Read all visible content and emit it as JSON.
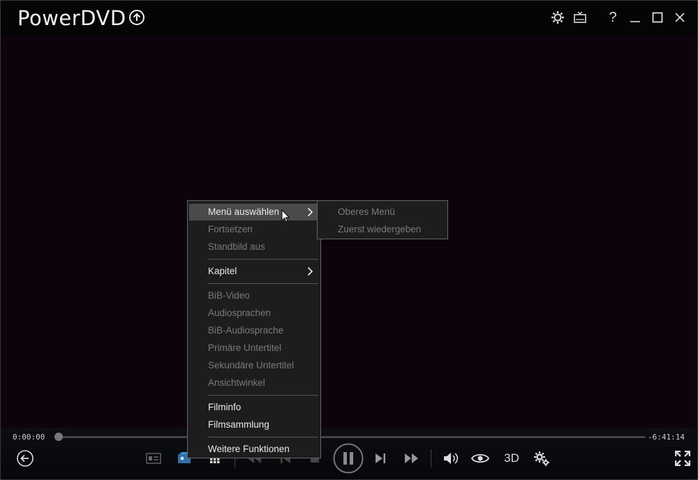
{
  "app": {
    "title": "PowerDVD"
  },
  "titlebar": {
    "icons": [
      "upgrade-icon",
      "gear-icon",
      "tv-mode-icon",
      "help-icon",
      "minimize-icon",
      "maximize-icon",
      "close-icon"
    ],
    "help_glyph": "?"
  },
  "player": {
    "time_elapsed": "0:00:00",
    "time_remaining": "-6:41:14",
    "progress": 0.0,
    "label_3d": "3D"
  },
  "context_menu": {
    "items": [
      {
        "label": "Menü auswählen",
        "enabled": true,
        "submenu": true,
        "highlighted": true
      },
      {
        "label": "Fortsetzen",
        "enabled": false
      },
      {
        "label": "Standbild aus",
        "enabled": false
      },
      {
        "label": "Kapitel",
        "enabled": true,
        "submenu": true
      },
      {
        "label": "BiB-Video",
        "enabled": false
      },
      {
        "label": "Audiosprachen",
        "enabled": false
      },
      {
        "label": "BiB-Audiosprache",
        "enabled": false
      },
      {
        "label": "Primäre Untertitel",
        "enabled": false
      },
      {
        "label": "Sekundäre Untertitel",
        "enabled": false
      },
      {
        "label": "Ansichtwinkel",
        "enabled": false
      },
      {
        "label": "Filminfo",
        "enabled": true
      },
      {
        "label": "Filmsammlung",
        "enabled": true
      },
      {
        "label": "Weitere Funktionen",
        "enabled": true
      }
    ]
  },
  "submenu": {
    "items": [
      {
        "label": "Oberes Menü",
        "enabled": false
      },
      {
        "label": "Zuerst wiedergeben",
        "enabled": false
      }
    ]
  },
  "colors": {
    "accent": "#3a8fd6",
    "menu_bg": "#1d1d1d",
    "highlight": "#4a4a4a"
  }
}
